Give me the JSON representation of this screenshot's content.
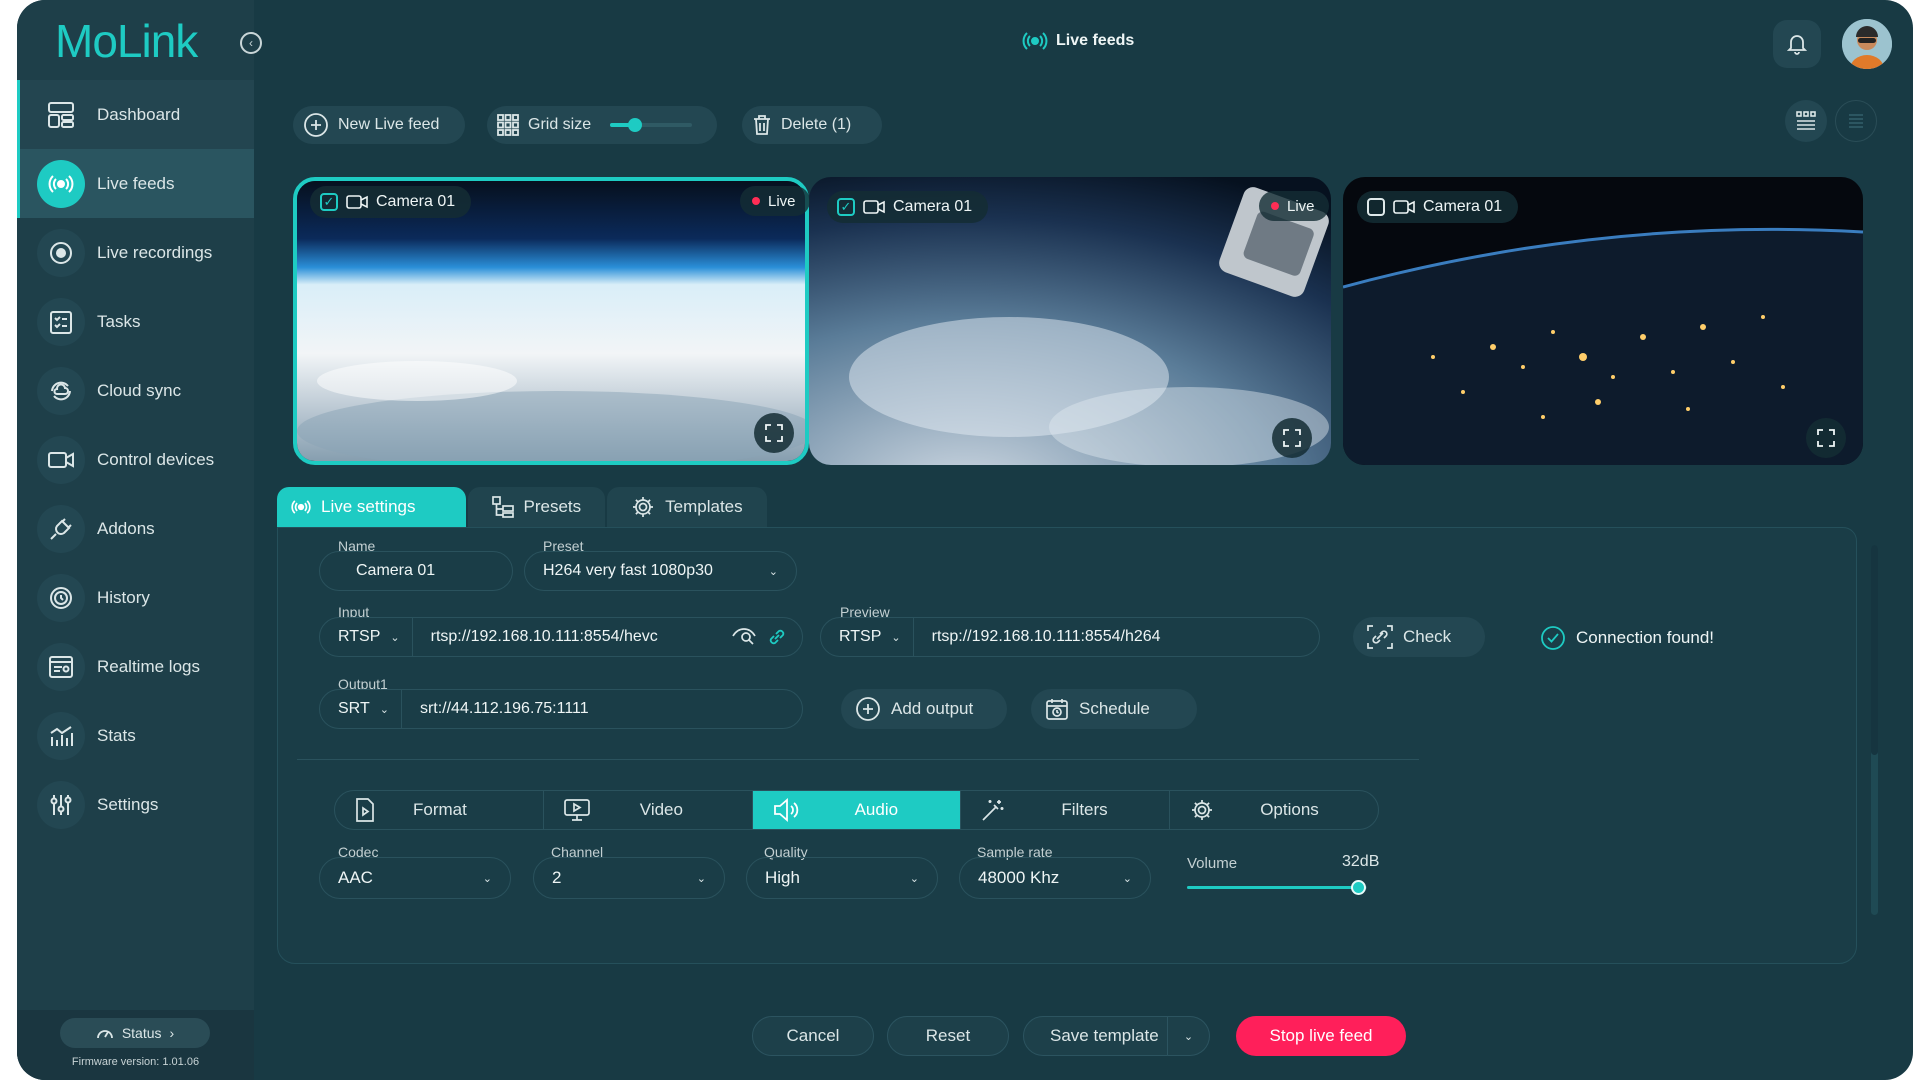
{
  "app": {
    "logo": "MoLink",
    "page_title": "Live feeds"
  },
  "sidebar": {
    "items": [
      {
        "label": "Dashboard",
        "icon": "dashboard-icon"
      },
      {
        "label": "Live feeds",
        "icon": "broadcast-icon"
      },
      {
        "label": "Live recordings",
        "icon": "record-icon"
      },
      {
        "label": "Tasks",
        "icon": "tasks-icon"
      },
      {
        "label": "Cloud sync",
        "icon": "cloud-sync-icon"
      },
      {
        "label": "Control devices",
        "icon": "camera-icon"
      },
      {
        "label": "Addons",
        "icon": "plug-icon"
      },
      {
        "label": "History",
        "icon": "history-icon"
      },
      {
        "label": "Realtime logs",
        "icon": "logs-icon"
      },
      {
        "label": "Stats",
        "icon": "stats-icon"
      },
      {
        "label": "Settings",
        "icon": "sliders-icon"
      }
    ],
    "active": "Live feeds",
    "status_label": "Status",
    "firmware": "Firmware version:  1.01.06"
  },
  "toolbar": {
    "new_feed": "New Live feed",
    "grid_size": "Grid size",
    "grid_size_level": 0.3,
    "delete": "Delete (1)"
  },
  "cameras": [
    {
      "label": "Camera 01",
      "checked": true,
      "live": true,
      "live_label": "Live",
      "selected": true
    },
    {
      "label": "Camera 01",
      "checked": true,
      "live": true,
      "live_label": "Live",
      "selected": false
    },
    {
      "label": "Camera 01",
      "checked": false,
      "live": false,
      "selected": false
    }
  ],
  "settings_tabs": [
    {
      "label": "Live settings",
      "active": true
    },
    {
      "label": "Presets",
      "active": false
    },
    {
      "label": "Templates",
      "active": false
    }
  ],
  "form": {
    "name_label": "Name",
    "name_value": "Camera 01",
    "preset_label": "Preset",
    "preset_value": "H264 very fast 1080p30",
    "input_label": "Input",
    "input_protocol": "RTSP",
    "input_url": "rtsp://192.168.10.111:8554/hevc",
    "preview_label": "Preview",
    "preview_protocol": "RTSP",
    "preview_url": "rtsp://192.168.10.111:8554/h264",
    "check": "Check",
    "connection": "Connection found!",
    "output_label": "Output1",
    "output_protocol": "SRT",
    "output_url": "srt://44.112.196.75:1111",
    "add_output": "Add output",
    "schedule": "Schedule"
  },
  "stream_tabs": [
    {
      "label": "Format",
      "active": false
    },
    {
      "label": "Video",
      "active": false
    },
    {
      "label": "Audio",
      "active": true
    },
    {
      "label": "Filters",
      "active": false
    },
    {
      "label": "Options",
      "active": false
    }
  ],
  "audio": {
    "codec_label": "Codec",
    "codec": "AAC",
    "channel_label": "Channel",
    "channel": "2",
    "quality_label": "Quality",
    "quality": "High",
    "sample_rate_label": "Sample rate",
    "sample_rate": "48000 Khz",
    "volume_label": "Volume",
    "volume_value": "32dB",
    "volume_level": 0.95
  },
  "actions": {
    "cancel": "Cancel",
    "reset": "Reset",
    "save_template": "Save template",
    "stop": "Stop live feed"
  },
  "colors": {
    "accent": "#1ecbc3",
    "danger": "#ff1f5a",
    "background": "#183a44"
  }
}
